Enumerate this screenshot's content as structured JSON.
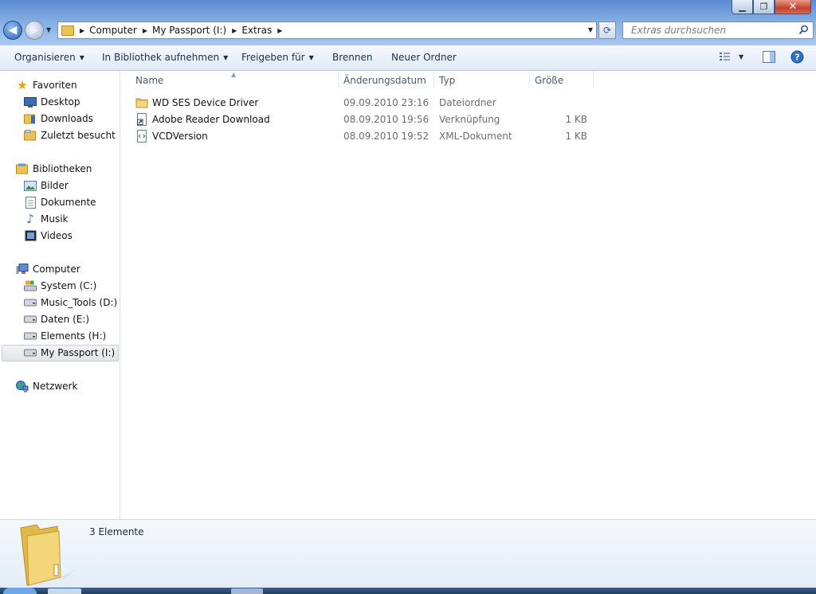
{
  "window": {
    "minimize_glyph": "▁",
    "maximize_glyph": "❐",
    "close_glyph": "✕"
  },
  "address": {
    "crumbs": [
      "Computer",
      "My Passport (I:)",
      "Extras"
    ]
  },
  "search": {
    "placeholder": "Extras durchsuchen"
  },
  "toolbar": {
    "organize": "Organisieren",
    "include_library": "In Bibliothek aufnehmen",
    "share": "Freigeben für",
    "burn": "Brennen",
    "new_folder": "Neuer Ordner"
  },
  "nav": {
    "favorites": {
      "label": "Favoriten",
      "items": [
        "Desktop",
        "Downloads",
        "Zuletzt besucht"
      ]
    },
    "libraries": {
      "label": "Bibliotheken",
      "items": [
        "Bilder",
        "Dokumente",
        "Musik",
        "Videos"
      ]
    },
    "computer": {
      "label": "Computer",
      "items": [
        "System (C:)",
        "Music_Tools (D:)",
        "Daten (E:)",
        "Elements (H:)",
        "My Passport (I:)"
      ]
    },
    "network": {
      "label": "Netzwerk"
    }
  },
  "columns": {
    "name": "Name",
    "date": "Änderungsdatum",
    "type": "Typ",
    "size": "Größe"
  },
  "files": [
    {
      "name": "WD SES Device Driver",
      "date": "09.09.2010 23:16",
      "type": "Dateiordner",
      "size": "",
      "icon": "folder-icon"
    },
    {
      "name": "Adobe Reader Download",
      "date": "08.09.2010 19:56",
      "type": "Verknüpfung",
      "size": "1 KB",
      "icon": "shortcut-icon"
    },
    {
      "name": "VCDVersion",
      "date": "08.09.2010 19:52",
      "type": "XML-Dokument",
      "size": "1 KB",
      "icon": "xml-file-icon"
    }
  ],
  "details": {
    "count": "3 Elemente"
  },
  "colors": {
    "accent": "#2a62b6",
    "folder": "#e9c25a",
    "toolbar_text": "#1c2e4a"
  }
}
